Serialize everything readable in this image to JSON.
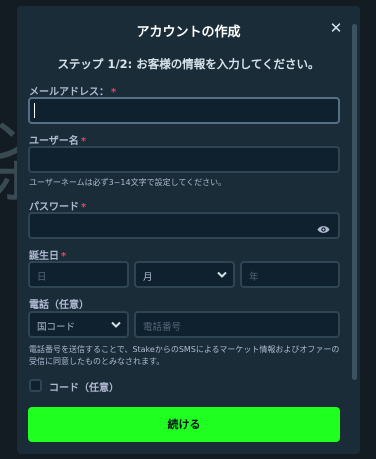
{
  "modal": {
    "title": "アカウントの作成",
    "step": "ステップ 1/2: お客様の情報を入力してください。"
  },
  "email": {
    "label": "メールアドレス：",
    "required": "*",
    "value": ""
  },
  "username": {
    "label": "ユーザー名",
    "required": "*",
    "value": "",
    "hint": "ユーザーネームは必ず3~14文字で設定してください。"
  },
  "password": {
    "label": "パスワード",
    "required": "*",
    "value": ""
  },
  "birthdate": {
    "label": "誕生日",
    "required": "*",
    "day_placeholder": "日",
    "month_value": "月",
    "year_placeholder": "年"
  },
  "phone": {
    "label": "電話（任意）",
    "country_code_value": "国コード",
    "number_placeholder": "電話番号",
    "notice": "電話番号を送信することで、StakeからのSMSによるマーケット情報およびオファーの受信に同意したものとみなされます。"
  },
  "code": {
    "label": "コード（任意）",
    "checked": false
  },
  "actions": {
    "continue_label": "続ける"
  },
  "icons": {
    "close": "close-icon",
    "eye": "eye-icon",
    "chevron": "chevron-down-icon"
  },
  "colors": {
    "accent": "#1fff20",
    "modal_bg": "#1a2c38",
    "input_bg": "#0f212e",
    "required": "#ed4163"
  }
}
